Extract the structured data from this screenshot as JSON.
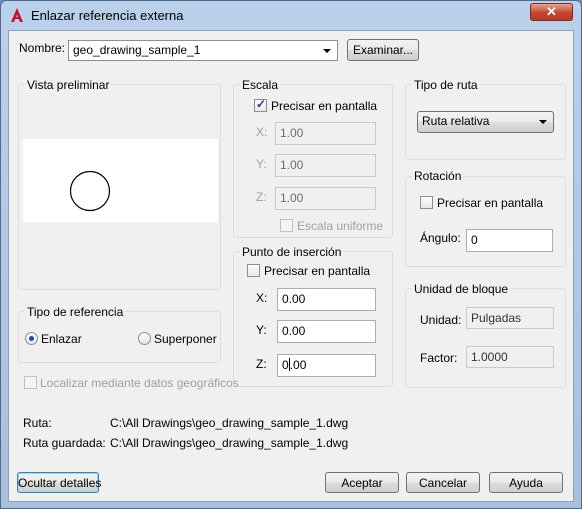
{
  "window": {
    "title": "Enlazar referencia externa",
    "close_glyph": "✕"
  },
  "nombre": {
    "label": "Nombre:",
    "value": "geo_drawing_sample_1",
    "browse_label": "Examinar..."
  },
  "preview": {
    "label": "Vista preliminar"
  },
  "scale": {
    "label": "Escala",
    "on_screen_label": "Precisar en pantalla",
    "on_screen_checked": true,
    "x_label": "X:",
    "x_value": "1.00",
    "y_label": "Y:",
    "y_value": "1.00",
    "z_label": "Z:",
    "z_value": "1.00",
    "uniform_label": "Escala uniforme",
    "uniform_checked": false
  },
  "path_type": {
    "label": "Tipo de ruta",
    "value": "Ruta relativa"
  },
  "rotation": {
    "label": "Rotación",
    "on_screen_label": "Precisar en pantalla",
    "on_screen_checked": false,
    "angle_label": "Ángulo:",
    "angle_value": "0"
  },
  "insertion": {
    "label": "Punto de inserción",
    "on_screen_label": "Precisar en pantalla",
    "on_screen_checked": false,
    "x_label": "X:",
    "x_value": "0.00",
    "y_label": "Y:",
    "y_value": "0.00",
    "z_label": "Z:",
    "z_value_a": "0",
    "z_value_b": ".00"
  },
  "block_unit": {
    "label": "Unidad de bloque",
    "unit_label": "Unidad:",
    "unit_value": "Pulgadas",
    "factor_label": "Factor:",
    "factor_value": "1.0000"
  },
  "ref_type": {
    "label": "Tipo de referencia",
    "attach_label": "Enlazar",
    "overlay_label": "Superponer",
    "selected": "Enlazar"
  },
  "geo": {
    "label": "Localizar mediante datos geográficos",
    "checked": false
  },
  "paths": {
    "path_label": "Ruta:",
    "path_value": "C:\\All Drawings\\geo_drawing_sample_1.dwg",
    "saved_label": "Ruta guardada:",
    "saved_value": "C:\\All Drawings\\geo_drawing_sample_1.dwg"
  },
  "buttons": {
    "details": "Ocultar detalles",
    "ok": "Aceptar",
    "cancel": "Cancelar",
    "help": "Ayuda"
  },
  "colors": {
    "accent": "#1f4f9a",
    "logo_red": "#c8102e",
    "close_red": "#c7452f"
  }
}
